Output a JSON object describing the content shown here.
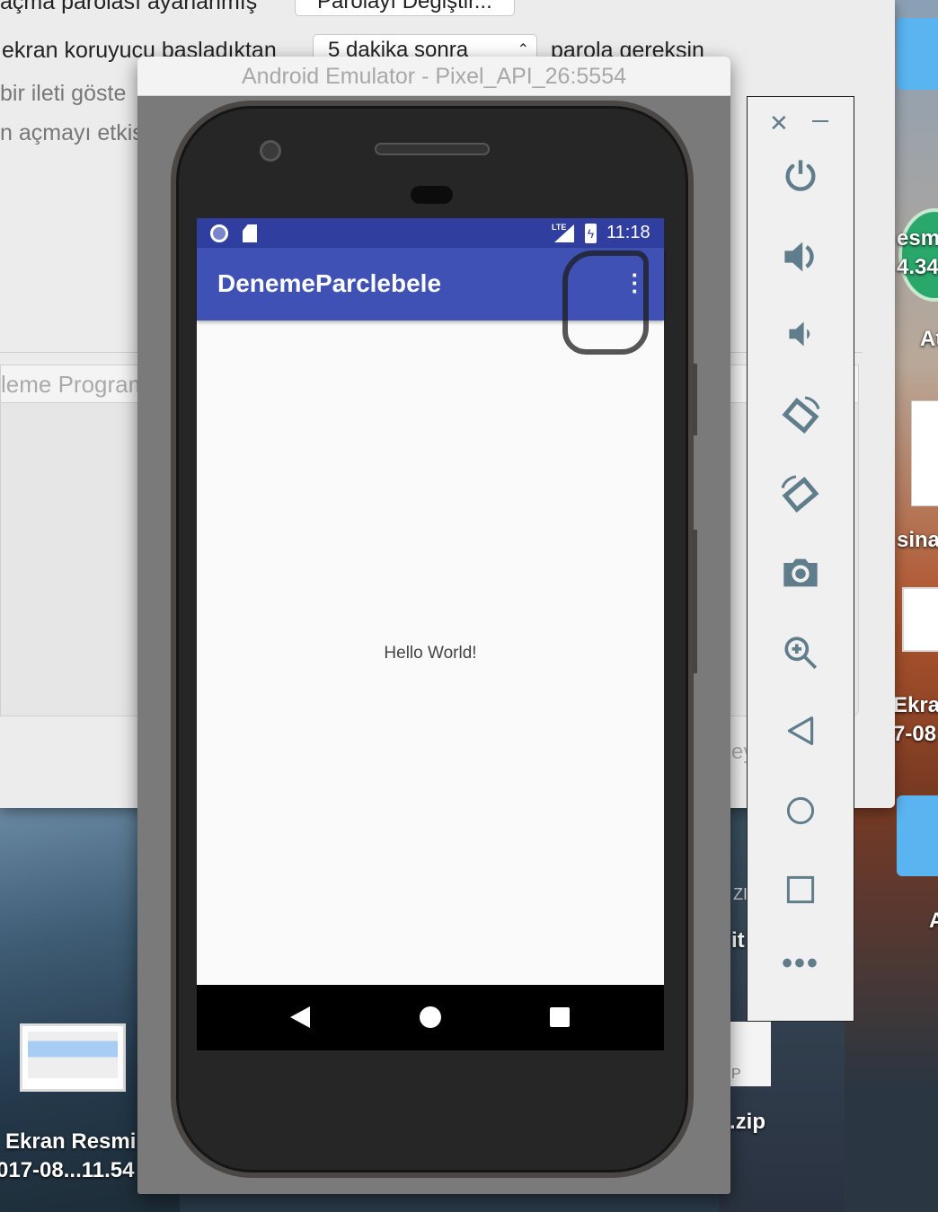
{
  "settings": {
    "line1": "açma parolası ayarlanmış",
    "change_password_button": "Parolayı Değiştir...",
    "line2_prefix": "ekran koruyucu başladıktan",
    "delay_select": "5 dakika sonra",
    "line2_suffix": "parola gereksin",
    "line3": "bir ileti göste",
    "line4": "n açmayı etkis",
    "list_header": "leme Program",
    "partial": "ey"
  },
  "emulator": {
    "title": "Android Emulator - Pixel_API_26:5554",
    "status_time": "11:18",
    "status_network": "LTE",
    "app_title": "DenemeParclebele",
    "content_text": "Hello World!"
  },
  "toolbar": {
    "buttons": [
      "close",
      "minimize",
      "power",
      "volume-up",
      "volume-down",
      "rotate-left",
      "rotate-right",
      "screenshot",
      "zoom",
      "back",
      "home",
      "overview",
      "more"
    ]
  },
  "desktop": {
    "left_file_name": "Ekran Resmi",
    "left_file_date": "017-08...11.54",
    "right_labels": [
      "esm",
      "4.34",
      "At",
      "sina",
      "Ekra",
      "7-08",
      "A"
    ],
    "mid_labels": [
      "ZI",
      "it",
      "P",
      ".zip"
    ]
  },
  "colors": {
    "primary": "#3f51b5",
    "primary_dark": "#303f9f",
    "icon": "#607d8b"
  }
}
